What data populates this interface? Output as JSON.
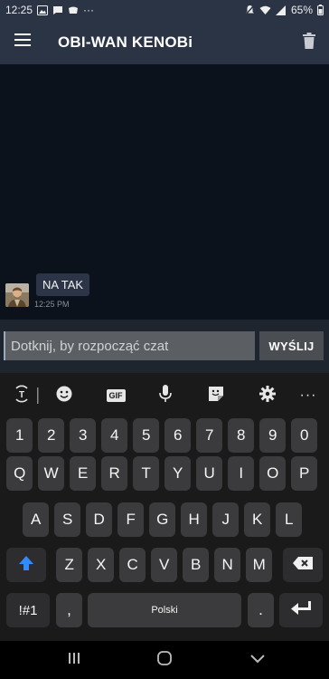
{
  "status_bar": {
    "time": "12:25",
    "extra": "···",
    "battery": "65%"
  },
  "app_bar": {
    "title": "OBI-WAN KENOBi",
    "menu_icon": "hamburger-menu-icon",
    "delete_icon": "trash-icon"
  },
  "chat": {
    "messages": [
      {
        "text": "NA TAK",
        "time": "12:25 PM",
        "avatar": "contact-avatar"
      }
    ]
  },
  "composer": {
    "placeholder": "Dotknij, by rozpocząć czat",
    "value": "",
    "send_label": "WYŚLIJ"
  },
  "keyboard": {
    "toolbar": [
      "translate-icon",
      "emoji-icon",
      "GIF",
      "mic-icon",
      "sticker-icon",
      "settings-icon",
      "more-icon"
    ],
    "gif_label": "GIF",
    "more_label": "···",
    "row_numbers": [
      "1",
      "2",
      "3",
      "4",
      "5",
      "6",
      "7",
      "8",
      "9",
      "0"
    ],
    "row_1": [
      "Q",
      "W",
      "E",
      "R",
      "T",
      "Y",
      "U",
      "I",
      "O",
      "P"
    ],
    "row_2": [
      "A",
      "S",
      "D",
      "F",
      "G",
      "H",
      "J",
      "K",
      "L"
    ],
    "row_3": [
      "Z",
      "X",
      "C",
      "V",
      "B",
      "N",
      "M"
    ],
    "symbols_label": "!#1",
    "comma_label": ",",
    "space_label": "Polski",
    "period_label": "."
  },
  "colors": {
    "app_bar": "#2a3444",
    "chat_bg": "#0b121b",
    "bubble": "#2b3547",
    "shift_accent": "#2f8bff"
  }
}
